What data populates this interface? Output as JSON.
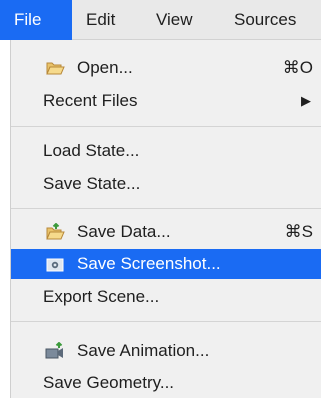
{
  "menubar": {
    "items": [
      {
        "label": "File"
      },
      {
        "label": "Edit"
      },
      {
        "label": "View"
      },
      {
        "label": "Sources"
      }
    ]
  },
  "menu": {
    "open": {
      "label": "Open...",
      "shortcut": "⌘O",
      "icon": "folder-open-icon"
    },
    "recent": {
      "label": "Recent Files",
      "submenu_indicator": "▶"
    },
    "load_state": {
      "label": "Load State..."
    },
    "save_state": {
      "label": "Save State..."
    },
    "save_data": {
      "label": "Save Data...",
      "shortcut": "⌘S",
      "icon": "folder-save-icon"
    },
    "save_screenshot": {
      "label": "Save Screenshot...",
      "icon": "screenshot-icon"
    },
    "export_scene": {
      "label": "Export Scene..."
    },
    "save_animation": {
      "label": "Save Animation...",
      "icon": "animation-icon"
    },
    "save_geometry": {
      "label": "Save Geometry..."
    }
  },
  "colors": {
    "highlight": "#1a6bf3",
    "menubar_bg": "#e9e9e9",
    "menu_bg": "#f0f0f0"
  }
}
